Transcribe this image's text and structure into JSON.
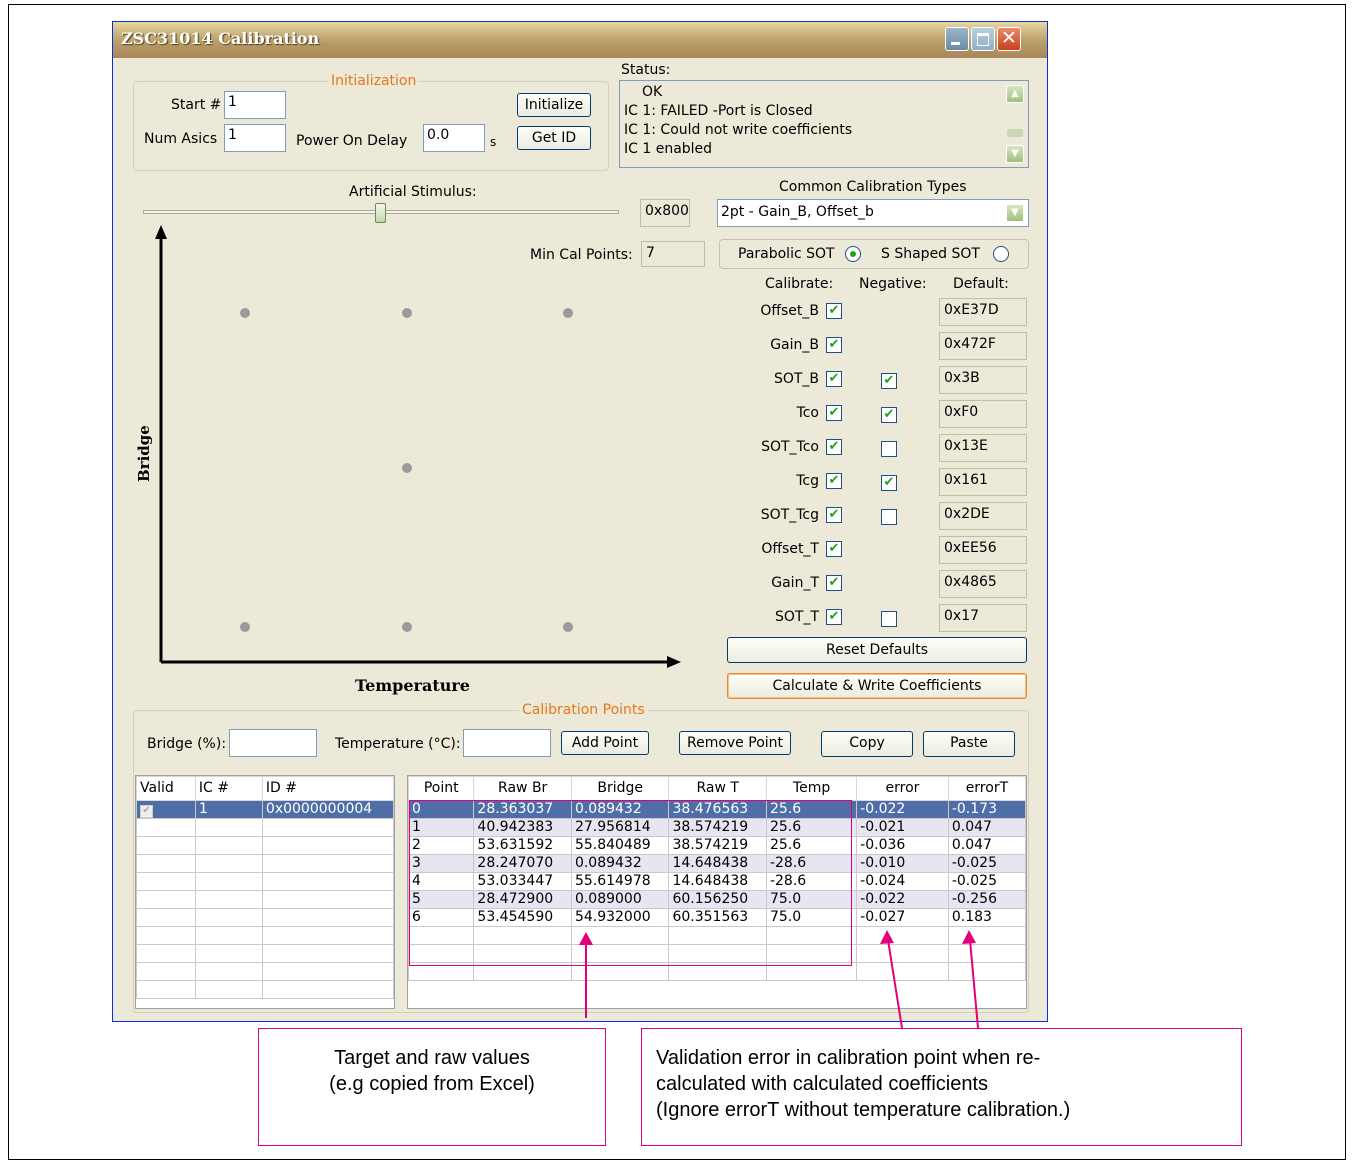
{
  "window": {
    "title": "ZSC31014 Calibration"
  },
  "initialization": {
    "legend": "Initialization",
    "start_label": "Start #",
    "start_value": "1",
    "num_asics_label": "Num Asics",
    "num_asics_value": "1",
    "power_on_delay_label": "Power On Delay",
    "power_on_delay_value": "0.0",
    "power_on_delay_unit": "s",
    "initialize_button": "Initialize",
    "get_id_button": "Get ID"
  },
  "status": {
    "label": "Status:",
    "lines": [
      "OK",
      "IC 1: FAILED -Port is Closed",
      "IC 1: Could not write coefficients",
      "IC 1 enabled"
    ]
  },
  "stimulus": {
    "label": "Artificial Stimulus:",
    "value": "0x800",
    "slider_fraction": 0.5
  },
  "calibration_types": {
    "label": "Common Calibration Types",
    "selected": "2pt - Gain_B, Offset_b"
  },
  "min_cal_points": {
    "label": "Min Cal Points:",
    "value": "7"
  },
  "sot": {
    "parabolic_label": "Parabolic SOT",
    "parabolic_selected": true,
    "s_shaped_label": "S Shaped SOT",
    "s_shaped_selected": false
  },
  "coeff_headers": {
    "calibrate": "Calibrate:",
    "negative": "Negative:",
    "default": "Default:"
  },
  "coefficients": [
    {
      "name": "Offset_B",
      "calibrate": true,
      "negative": null,
      "default": "0xE37D"
    },
    {
      "name": "Gain_B",
      "calibrate": true,
      "negative": null,
      "default": "0x472F"
    },
    {
      "name": "SOT_B",
      "calibrate": true,
      "negative": true,
      "default": "0x3B"
    },
    {
      "name": "Tco",
      "calibrate": true,
      "negative": true,
      "default": "0xF0"
    },
    {
      "name": "SOT_Tco",
      "calibrate": true,
      "negative": false,
      "default": "0x13E"
    },
    {
      "name": "Tcg",
      "calibrate": true,
      "negative": true,
      "default": "0x161"
    },
    {
      "name": "SOT_Tcg",
      "calibrate": true,
      "negative": false,
      "default": "0x2DE"
    },
    {
      "name": "Offset_T",
      "calibrate": true,
      "negative": null,
      "default": "0xEE56"
    },
    {
      "name": "Gain_T",
      "calibrate": true,
      "negative": null,
      "default": "0x4865"
    },
    {
      "name": "SOT_T",
      "calibrate": true,
      "negative": false,
      "default": "0x17"
    }
  ],
  "buttons": {
    "reset_defaults": "Reset Defaults",
    "calculate_write": "Calculate & Write Coefficients"
  },
  "plot": {
    "y_label": "Bridge",
    "x_label": "Temperature",
    "dots": [
      [
        0,
        1
      ],
      [
        1,
        1
      ],
      [
        2,
        1
      ],
      [
        1,
        2
      ],
      [
        0,
        3
      ],
      [
        1,
        3
      ],
      [
        2,
        3
      ]
    ]
  },
  "calibration_points": {
    "legend": "Calibration Points",
    "bridge_label": "Bridge (%):",
    "bridge_value": "",
    "temperature_label": "Temperature (°C):",
    "temperature_value": "",
    "add_point": "Add Point",
    "remove_point": "Remove Point",
    "copy": "Copy",
    "paste": "Paste"
  },
  "ic_table": {
    "headers": [
      "Valid",
      "IC #",
      "ID #"
    ],
    "rows": [
      {
        "valid": true,
        "ic": "1",
        "id": "0x0000000004"
      }
    ]
  },
  "points_table": {
    "headers": [
      "Point",
      "Raw Br",
      "Bridge",
      "Raw T",
      "Temp",
      "error",
      "errorT"
    ],
    "rows": [
      [
        "0",
        "28.363037",
        "0.089432",
        "38.476563",
        "25.6",
        "-0.022",
        "-0.173"
      ],
      [
        "1",
        "40.942383",
        "27.956814",
        "38.574219",
        "25.6",
        "-0.021",
        "0.047"
      ],
      [
        "2",
        "53.631592",
        "55.840489",
        "38.574219",
        "25.6",
        "-0.036",
        "0.047"
      ],
      [
        "3",
        "28.247070",
        "0.089432",
        "14.648438",
        "-28.6",
        "-0.010",
        "-0.025"
      ],
      [
        "4",
        "53.033447",
        "55.614978",
        "14.648438",
        "-28.6",
        "-0.024",
        "-0.025"
      ],
      [
        "5",
        "28.472900",
        "0.089000",
        "60.156250",
        "75.0",
        "-0.022",
        "-0.256"
      ],
      [
        "6",
        "53.454590",
        "54.932000",
        "60.351563",
        "75.0",
        "-0.027",
        "0.183"
      ]
    ]
  },
  "callouts": {
    "left": [
      "Target and raw values",
      "(e.g copied from Excel)"
    ],
    "right": [
      "Validation error in calibration point when re-",
      "calculated with calculated coefficients",
      "(Ignore errorT without temperature calibration.)"
    ]
  },
  "colors": {
    "callout": "#e2007a",
    "legend": "#e8761c",
    "selection": "#4f6ea8",
    "check": "#21a121"
  }
}
